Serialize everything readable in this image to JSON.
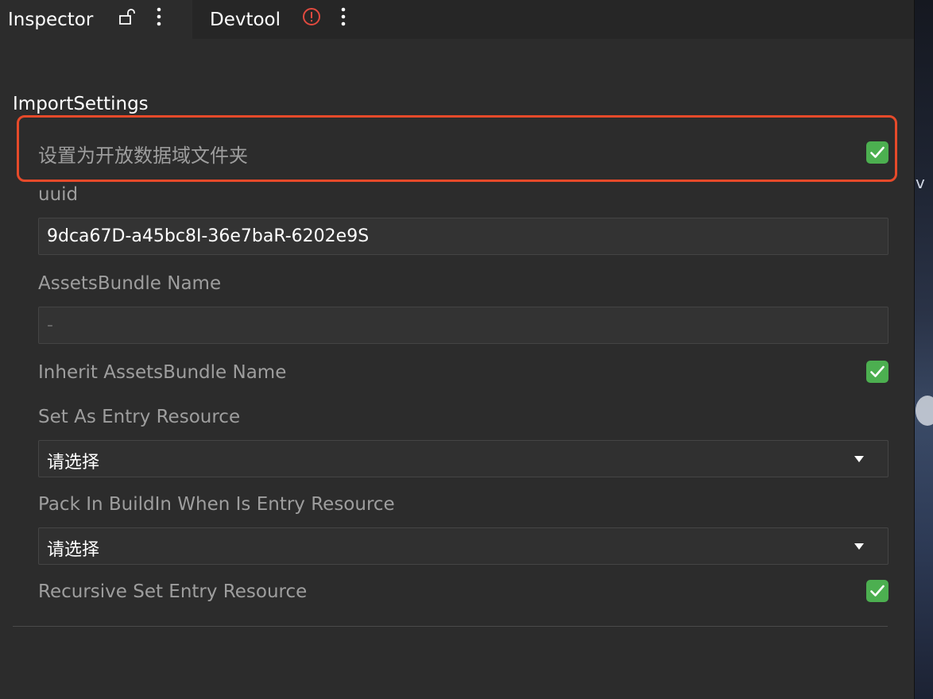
{
  "tabs": [
    {
      "title": "Inspector",
      "icons": [
        "lock-icon",
        "more-vertical-icon"
      ],
      "active": true
    },
    {
      "title": "Devtool",
      "icons": [
        "error-circle-icon",
        "more-vertical-icon"
      ],
      "active": false
    }
  ],
  "colors": {
    "background": "#2c2c2c",
    "tab_bar": "#262626",
    "highlight": "#e64a2a",
    "checkbox": "#4caf50",
    "error": "#e04a3f",
    "label": "#9e9e9e"
  },
  "section": {
    "title": "ImportSettings"
  },
  "settings": {
    "open_data_folder": {
      "label": "设置为开放数据域文件夹",
      "checked": true
    },
    "uuid": {
      "label": "uuid",
      "value": "9dca67D-a45bc8I-36e7baR-6202e9S"
    },
    "assets_bundle_name": {
      "label": "AssetsBundle Name",
      "placeholder": "-"
    },
    "inherit_assets_bundle_name": {
      "label": "Inherit AssetsBundle Name",
      "checked": true
    },
    "set_as_entry_resource": {
      "label": "Set As Entry Resource",
      "value": "请选择"
    },
    "pack_in_buildin": {
      "label": "Pack In BuildIn When Is Entry Resource",
      "value": "请选择"
    },
    "recursive_set_entry": {
      "label": "Recursive Set Entry Resource",
      "checked": true
    }
  },
  "right_panel": {
    "partial_text": "v"
  }
}
